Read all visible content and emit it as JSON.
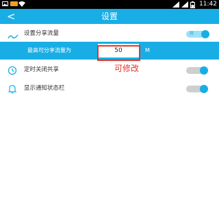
{
  "status_bar": {
    "time": "11:42"
  },
  "app_bar": {
    "back_label": "<",
    "title": "设置"
  },
  "settings": {
    "share_traffic": {
      "label": "设置分享流量",
      "toggle_on_text": "开",
      "enabled": true
    },
    "max_traffic": {
      "label": "最高可分享流量为",
      "value": "50",
      "unit": "M"
    },
    "timed_close": {
      "label": "定时关闭共享",
      "enabled": false
    },
    "show_notification": {
      "label": "显示通知状态栏",
      "enabled": false
    }
  },
  "annotation": {
    "note": "可修改",
    "color": "#e5342a"
  },
  "colors": {
    "accent": "#18aee5",
    "status_bar": "#000000",
    "background": "#ffffff"
  }
}
